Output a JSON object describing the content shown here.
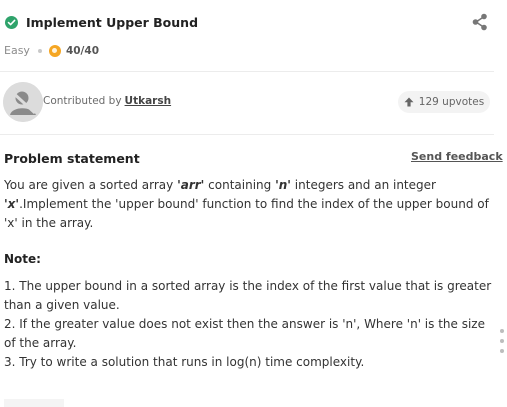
{
  "header": {
    "title": "Implement Upper Bound",
    "difficulty": "Easy",
    "score": "40/40"
  },
  "contributor": {
    "prefix": "Contributed by",
    "name": "Utkarsh",
    "upvotes": "129 upvotes"
  },
  "problem": {
    "heading": "Problem statement",
    "feedback_label": "Send feedback",
    "intro_part1": "You are given a sorted array ",
    "arr_term": "'arr'",
    "intro_part2": " containing ",
    "n_term": "'n'",
    "intro_part3": " integers and an integer ",
    "x_term": "'x'",
    "intro_part4": ".Implement the 'upper bound' function to find the index of the upper bound of 'x' in the array.",
    "note_heading": "Note:",
    "notes": [
      "1. The upper bound in a sorted array is the index of the first value that is greater than a given value.",
      "2. If the greater value does not exist then the answer is 'n', Where 'n' is the size of the array.",
      "3. Try to write a solution that runs in log(n) time complexity."
    ]
  },
  "colors": {
    "success": "#2fa36b",
    "coin": "#f5a623"
  },
  "icons": {
    "status": "check-circle-icon",
    "share": "share-icon",
    "coin": "coin-icon",
    "upvote": "arrow-up-icon"
  }
}
